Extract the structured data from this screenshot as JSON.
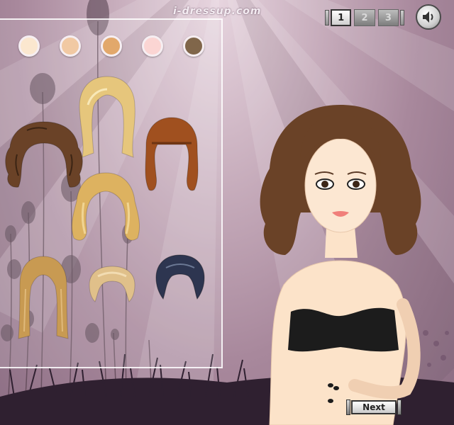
{
  "header": {
    "site_logo": "i-dressup.com",
    "page_tabs": [
      "1",
      "2",
      "3"
    ],
    "active_tab": "1",
    "sound_icon": "speaker-icon"
  },
  "skin_tones": [
    {
      "color": "#fbe7cf"
    },
    {
      "color": "#f1c9a3"
    },
    {
      "color": "#e2a86b"
    },
    {
      "color": "#fbd5d3"
    },
    {
      "color": "#80664a"
    }
  ],
  "hairstyles": [
    {
      "name": "hair-long-straight-blonde",
      "color": "#e6c67c"
    },
    {
      "name": "hair-curly-brown",
      "color": "#6a4227"
    },
    {
      "name": "hair-wavy-auburn",
      "color": "#a0501f"
    },
    {
      "name": "hair-wavy-golden-blonde",
      "color": "#ddb260"
    },
    {
      "name": "hair-straight-honey-blonde",
      "color": "#c89a52"
    },
    {
      "name": "hair-updo-blonde",
      "color": "#e0c08a"
    },
    {
      "name": "hair-short-navy",
      "color": "#2d3550"
    }
  ],
  "model": {
    "hair_color": "#6a4227",
    "top_color": "#1c1c1c"
  },
  "footer": {
    "next_label": "Next"
  }
}
